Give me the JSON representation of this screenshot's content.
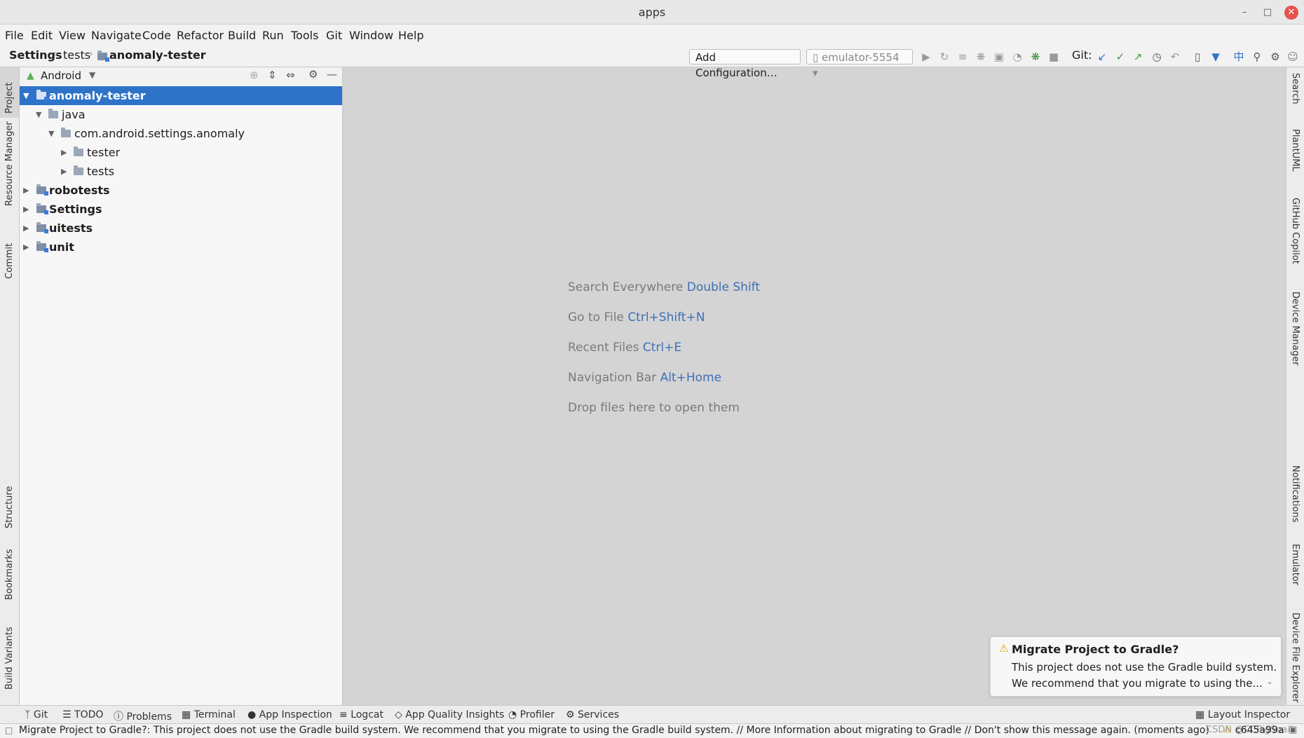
{
  "window": {
    "title": "apps"
  },
  "menu": [
    "File",
    "Edit",
    "View",
    "Navigate",
    "Code",
    "Refactor",
    "Build",
    "Run",
    "Tools",
    "Git",
    "Window",
    "Help"
  ],
  "breadcrumb": [
    "Settings",
    "tests",
    "anomaly-tester"
  ],
  "toolbar": {
    "add_config": "Add Configuration…",
    "device": "emulator-5554",
    "git_label": "Git:"
  },
  "left_tabs": [
    "Project",
    "Resource Manager",
    "Commit",
    "Structure",
    "Bookmarks",
    "Build Variants"
  ],
  "right_tabs": [
    "Search",
    "PlantUML",
    "GitHub Copilot",
    "Device Manager",
    "Notifications",
    "Emulator",
    "Device File Explorer"
  ],
  "project_panel": {
    "view": "Android",
    "tree": [
      {
        "label": "anomaly-tester",
        "bold": true,
        "selected": true
      },
      {
        "label": "java"
      },
      {
        "label": "com.android.settings.anomaly"
      },
      {
        "label": "tester"
      },
      {
        "label": "tests"
      },
      {
        "label": "robotests",
        "bold": true
      },
      {
        "label": "Settings",
        "bold": true
      },
      {
        "label": "uitests",
        "bold": true
      },
      {
        "label": "unit",
        "bold": true
      }
    ]
  },
  "editor_hints": [
    {
      "text": "Search Everywhere",
      "key": "Double Shift"
    },
    {
      "text": "Go to File",
      "key": "Ctrl+Shift+N"
    },
    {
      "text": "Recent Files",
      "key": "Ctrl+E"
    },
    {
      "text": "Navigation Bar",
      "key": "Alt+Home"
    },
    {
      "text": "Drop files here to open them",
      "key": ""
    }
  ],
  "notification": {
    "title": "Migrate Project to Gradle?",
    "line1": "This project does not use the Gradle build system.",
    "line2": "We recommend that you migrate to using the..."
  },
  "bottom_tabs": [
    "Git",
    "TODO",
    "Problems",
    "Terminal",
    "App Inspection",
    "Logcat",
    "App Quality Insights",
    "Profiler",
    "Services"
  ],
  "layout_inspector": "Layout Inspector",
  "status": {
    "message": "Migrate Project to Gradle?: This project does not use the Gradle build system. We recommend that you migrate to using the Gradle build system. // More Information about migrating to Gradle // Don't show this message again. (moments ago)",
    "commit": "c645a99a",
    "watermark": "CSDN @CCPigSnail"
  }
}
